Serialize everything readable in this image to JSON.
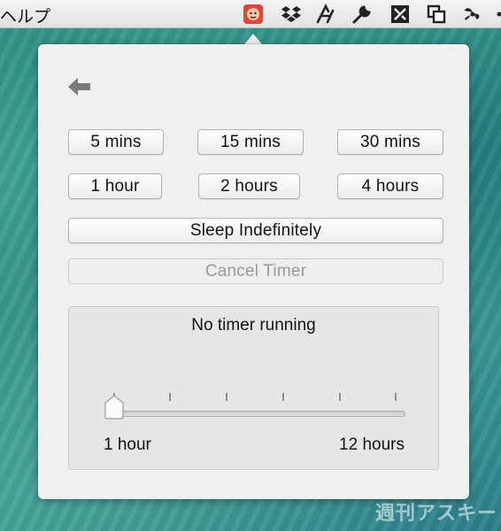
{
  "menubar": {
    "menu_label": "ヘルプ",
    "icons": [
      "caffeine-lion-icon",
      "dropbox-icon",
      "script-icon",
      "wrench-icon",
      "tools-icon",
      "windows-icon",
      "fan-icon"
    ],
    "accent_color": "#e0453a"
  },
  "popover": {
    "back_icon": "back-arrow-icon",
    "buttons_row1": [
      "5 mins",
      "15 mins",
      "30 mins"
    ],
    "buttons_row2": [
      "1 hour",
      "2 hours",
      "4 hours"
    ],
    "sleep_label": "Sleep Indefinitely",
    "cancel_label": "Cancel Timer",
    "status": "No timer running",
    "slider": {
      "min_label": "1 hour",
      "max_label": "12 hours",
      "value_hours": 1
    }
  },
  "watermark": "週刊アスキー"
}
